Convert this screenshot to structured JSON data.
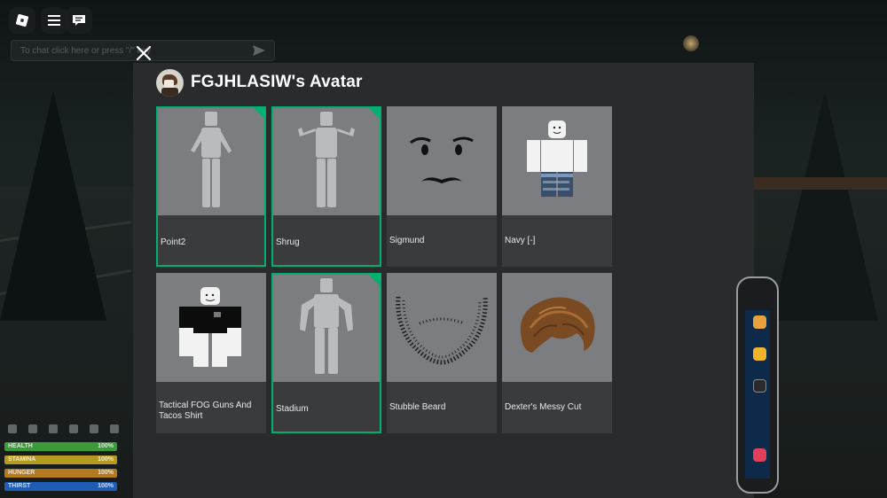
{
  "window": {
    "chat_placeholder": "To chat click here or press \"/\" key"
  },
  "modal": {
    "title": "FGJHLASIW's Avatar",
    "items": [
      {
        "label": "Point2",
        "selected": true,
        "icon": "emote-point-icon"
      },
      {
        "label": "Shrug",
        "selected": true,
        "icon": "emote-shrug-icon"
      },
      {
        "label": "Sigmund",
        "selected": false,
        "icon": "face-sigmund-icon"
      },
      {
        "label": "Navy [-]",
        "selected": false,
        "icon": "navy-outfit-icon"
      },
      {
        "label": "Tactical FOG Guns And Tacos Shirt",
        "selected": false,
        "icon": "shirt-icon"
      },
      {
        "label": "Stadium",
        "selected": true,
        "icon": "emote-stadium-icon"
      },
      {
        "label": "Stubble Beard",
        "selected": false,
        "icon": "beard-icon"
      },
      {
        "label": "Dexter's Messy Cut",
        "selected": false,
        "icon": "hair-icon"
      }
    ]
  },
  "hud": {
    "stats": [
      {
        "name": "HEALTH",
        "value": "100%",
        "color": "#3d9a3a"
      },
      {
        "name": "STAMINA",
        "value": "100%",
        "color": "#b59a22"
      },
      {
        "name": "HUNGER",
        "value": "100%",
        "color": "#b47a1f"
      },
      {
        "name": "THIRST",
        "value": "100%",
        "color": "#1f5db4"
      }
    ]
  },
  "colors": {
    "selected_border": "#00b06f",
    "modal_bg": "#2a2b2d",
    "thumb_bg": "#7b7d80"
  }
}
